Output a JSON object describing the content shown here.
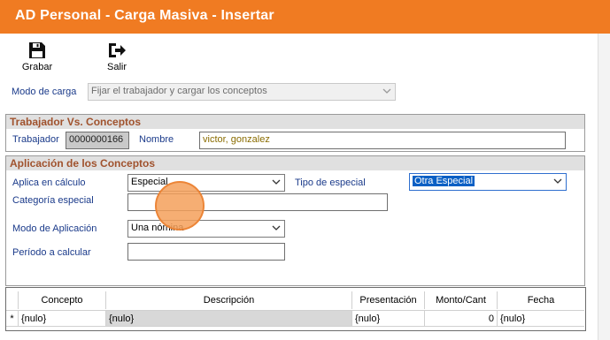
{
  "window": {
    "title": "AD Personal - Carga Masiva - Insertar"
  },
  "toolbar": {
    "grabar_label": "Grabar",
    "salir_label": "Salir"
  },
  "modo_carga": {
    "label": "Modo de carga",
    "value": "Fijar el trabajador y cargar los conceptos"
  },
  "trabajador_section": {
    "title": "Trabajador Vs. Conceptos",
    "trabajador_label": "Trabajador",
    "trabajador_value": "0000000166",
    "nombre_label": "Nombre",
    "nombre_value": "victor, gonzalez"
  },
  "aplicacion_section": {
    "title": "Aplicación de los Conceptos",
    "aplica_label": "Aplica en cálculo",
    "aplica_value": "Especial",
    "tipo_label": "Tipo de especial",
    "tipo_value": "Otra Especial",
    "categoria_label": "Categoría especial",
    "categoria_value": "",
    "modo_aplicacion_label": "Modo de Aplicación",
    "modo_aplicacion_value": "Una nómina",
    "periodo_label": "Período a calcular",
    "periodo_value": ""
  },
  "grid": {
    "columns": [
      "Concepto",
      "Descripción",
      "Presentación",
      "Monto/Cant",
      "Fecha"
    ],
    "row_marker": "*",
    "row": [
      "{nulo}",
      "{nulo}",
      "{nulo}",
      "0",
      "{nulo}"
    ]
  },
  "colors": {
    "title_bar": "#f07b22",
    "section_text": "#a0522d",
    "label_text": "#1a3a8a"
  }
}
